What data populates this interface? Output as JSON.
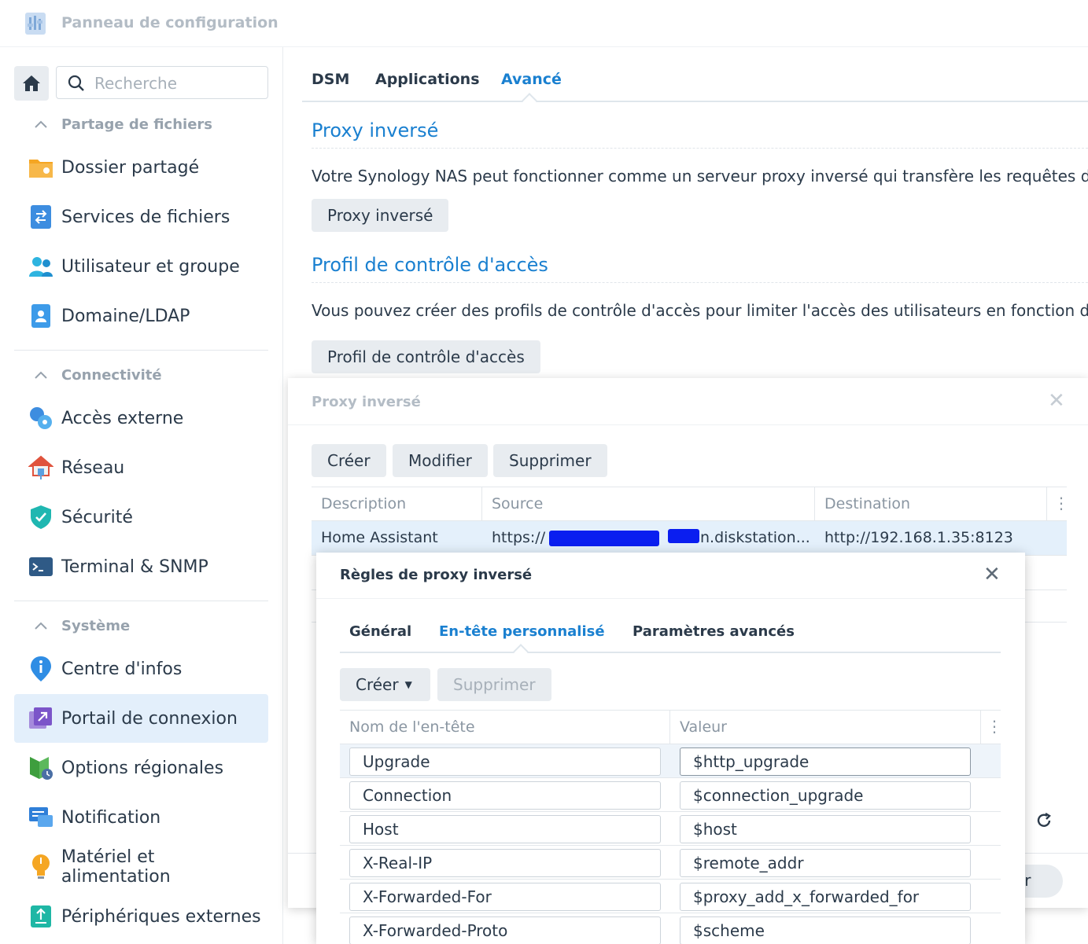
{
  "window": {
    "title": "Panneau de configuration"
  },
  "sidebar": {
    "search_placeholder": "Recherche",
    "sections": [
      {
        "label": "Partage de fichiers"
      },
      {
        "label": "Connectivité"
      },
      {
        "label": "Système"
      }
    ],
    "items": [
      {
        "label": "Dossier partagé",
        "icon": "shared-folder-icon"
      },
      {
        "label": "Services de fichiers",
        "icon": "file-services-icon"
      },
      {
        "label": "Utilisateur et groupe",
        "icon": "user-group-icon"
      },
      {
        "label": "Domaine/LDAP",
        "icon": "domain-ldap-icon"
      },
      {
        "label": "Accès externe",
        "icon": "external-access-icon"
      },
      {
        "label": "Réseau",
        "icon": "network-icon"
      },
      {
        "label": "Sécurité",
        "icon": "security-shield-icon"
      },
      {
        "label": "Terminal & SNMP",
        "icon": "terminal-icon"
      },
      {
        "label": "Centre d'infos",
        "icon": "info-center-icon"
      },
      {
        "label": "Portail de connexion",
        "icon": "login-portal-icon",
        "active": true
      },
      {
        "label": "Options régionales",
        "icon": "regional-options-icon"
      },
      {
        "label": "Notification",
        "icon": "notification-icon"
      },
      {
        "label": "Matériel et alimentation",
        "icon": "hardware-power-icon"
      },
      {
        "label": "Périphériques externes",
        "icon": "external-devices-icon"
      }
    ]
  },
  "main": {
    "tabs": [
      {
        "label": "DSM"
      },
      {
        "label": "Applications"
      },
      {
        "label": "Avancé",
        "active": true
      }
    ],
    "sections": [
      {
        "title": "Proxy inversé",
        "description": "Votre Synology NAS peut fonctionner comme un serveur proxy inversé qui transfère les requêtes d'In",
        "button": "Proxy inversé"
      },
      {
        "title": "Profil de contrôle d'accès",
        "description": "Vous pouvez créer des profils de contrôle d'accès pour limiter l'accès des utilisateurs en fonction de l",
        "button": "Profil de contrôle d'accès"
      }
    ]
  },
  "proxy_dialog": {
    "title": "Proxy inversé",
    "buttons": {
      "create": "Créer",
      "edit": "Modifier",
      "delete": "Supprimer"
    },
    "columns": [
      "Description",
      "Source",
      "Destination"
    ],
    "rows": [
      {
        "description": "Home Assistant",
        "source_prefix": "https://",
        "source_suffix": "n.diskstation...",
        "destination": "http://192.168.1.35:8123"
      }
    ],
    "footer_button": "er"
  },
  "rules_dialog": {
    "title": "Règles de proxy inversé",
    "tabs": [
      {
        "label": "Général"
      },
      {
        "label": "En-tête personnalisé",
        "active": true
      },
      {
        "label": "Paramètres avancés"
      }
    ],
    "buttons": {
      "create": "Créer",
      "delete": "Supprimer"
    },
    "columns": [
      "Nom de l'en-tête",
      "Valeur"
    ],
    "headers": [
      {
        "name": "Upgrade",
        "value": "$http_upgrade"
      },
      {
        "name": "Connection",
        "value": "$connection_upgrade"
      },
      {
        "name": "Host",
        "value": "$host"
      },
      {
        "name": "X-Real-IP",
        "value": "$remote_addr"
      },
      {
        "name": "X-Forwarded-For",
        "value": "$proxy_add_x_forwarded_for"
      },
      {
        "name": "X-Forwarded-Proto",
        "value": "$scheme"
      }
    ]
  },
  "colors": {
    "accent": "#1a80d0",
    "active_bg": "#e3effb",
    "button_bg": "#e8ecf0"
  }
}
